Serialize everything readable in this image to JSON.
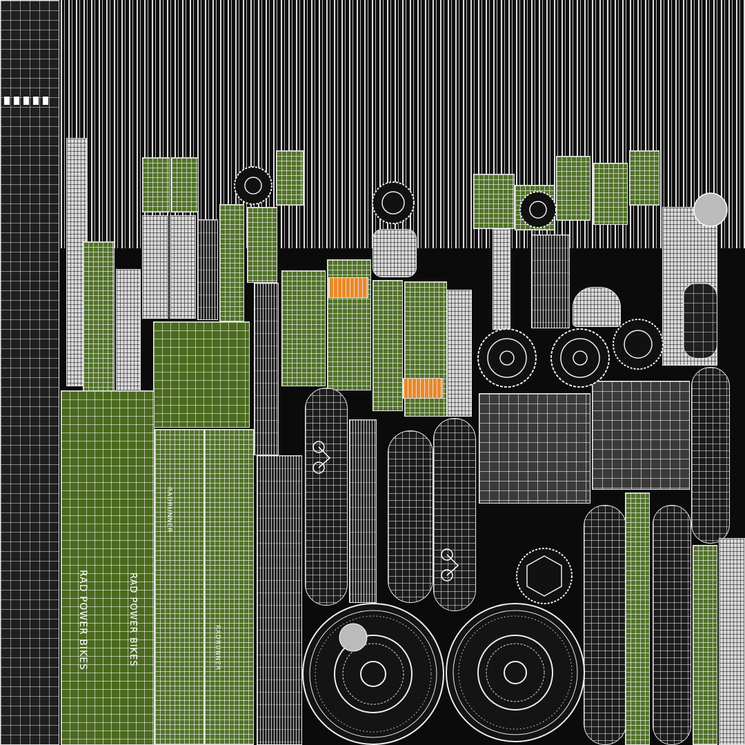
{
  "texture_labels": {
    "brand_primary": "RAD POWER BIKES",
    "brand_secondary": "RAD POWER BIKES",
    "model_primary": "RADRUNNER",
    "model_secondary": "RADRUNNER"
  },
  "colors": {
    "uv_fill_green": "#4a6a1e",
    "uv_fill_dark": "#1f1f1f",
    "uv_fill_grey": "#3a3a3a",
    "uv_accent_orange": "#e8892a",
    "wire": "#e8e8e8"
  },
  "icons": [
    "bike-logo-icon",
    "wheel-icon",
    "gear-icon",
    "sprocket-icon"
  ]
}
